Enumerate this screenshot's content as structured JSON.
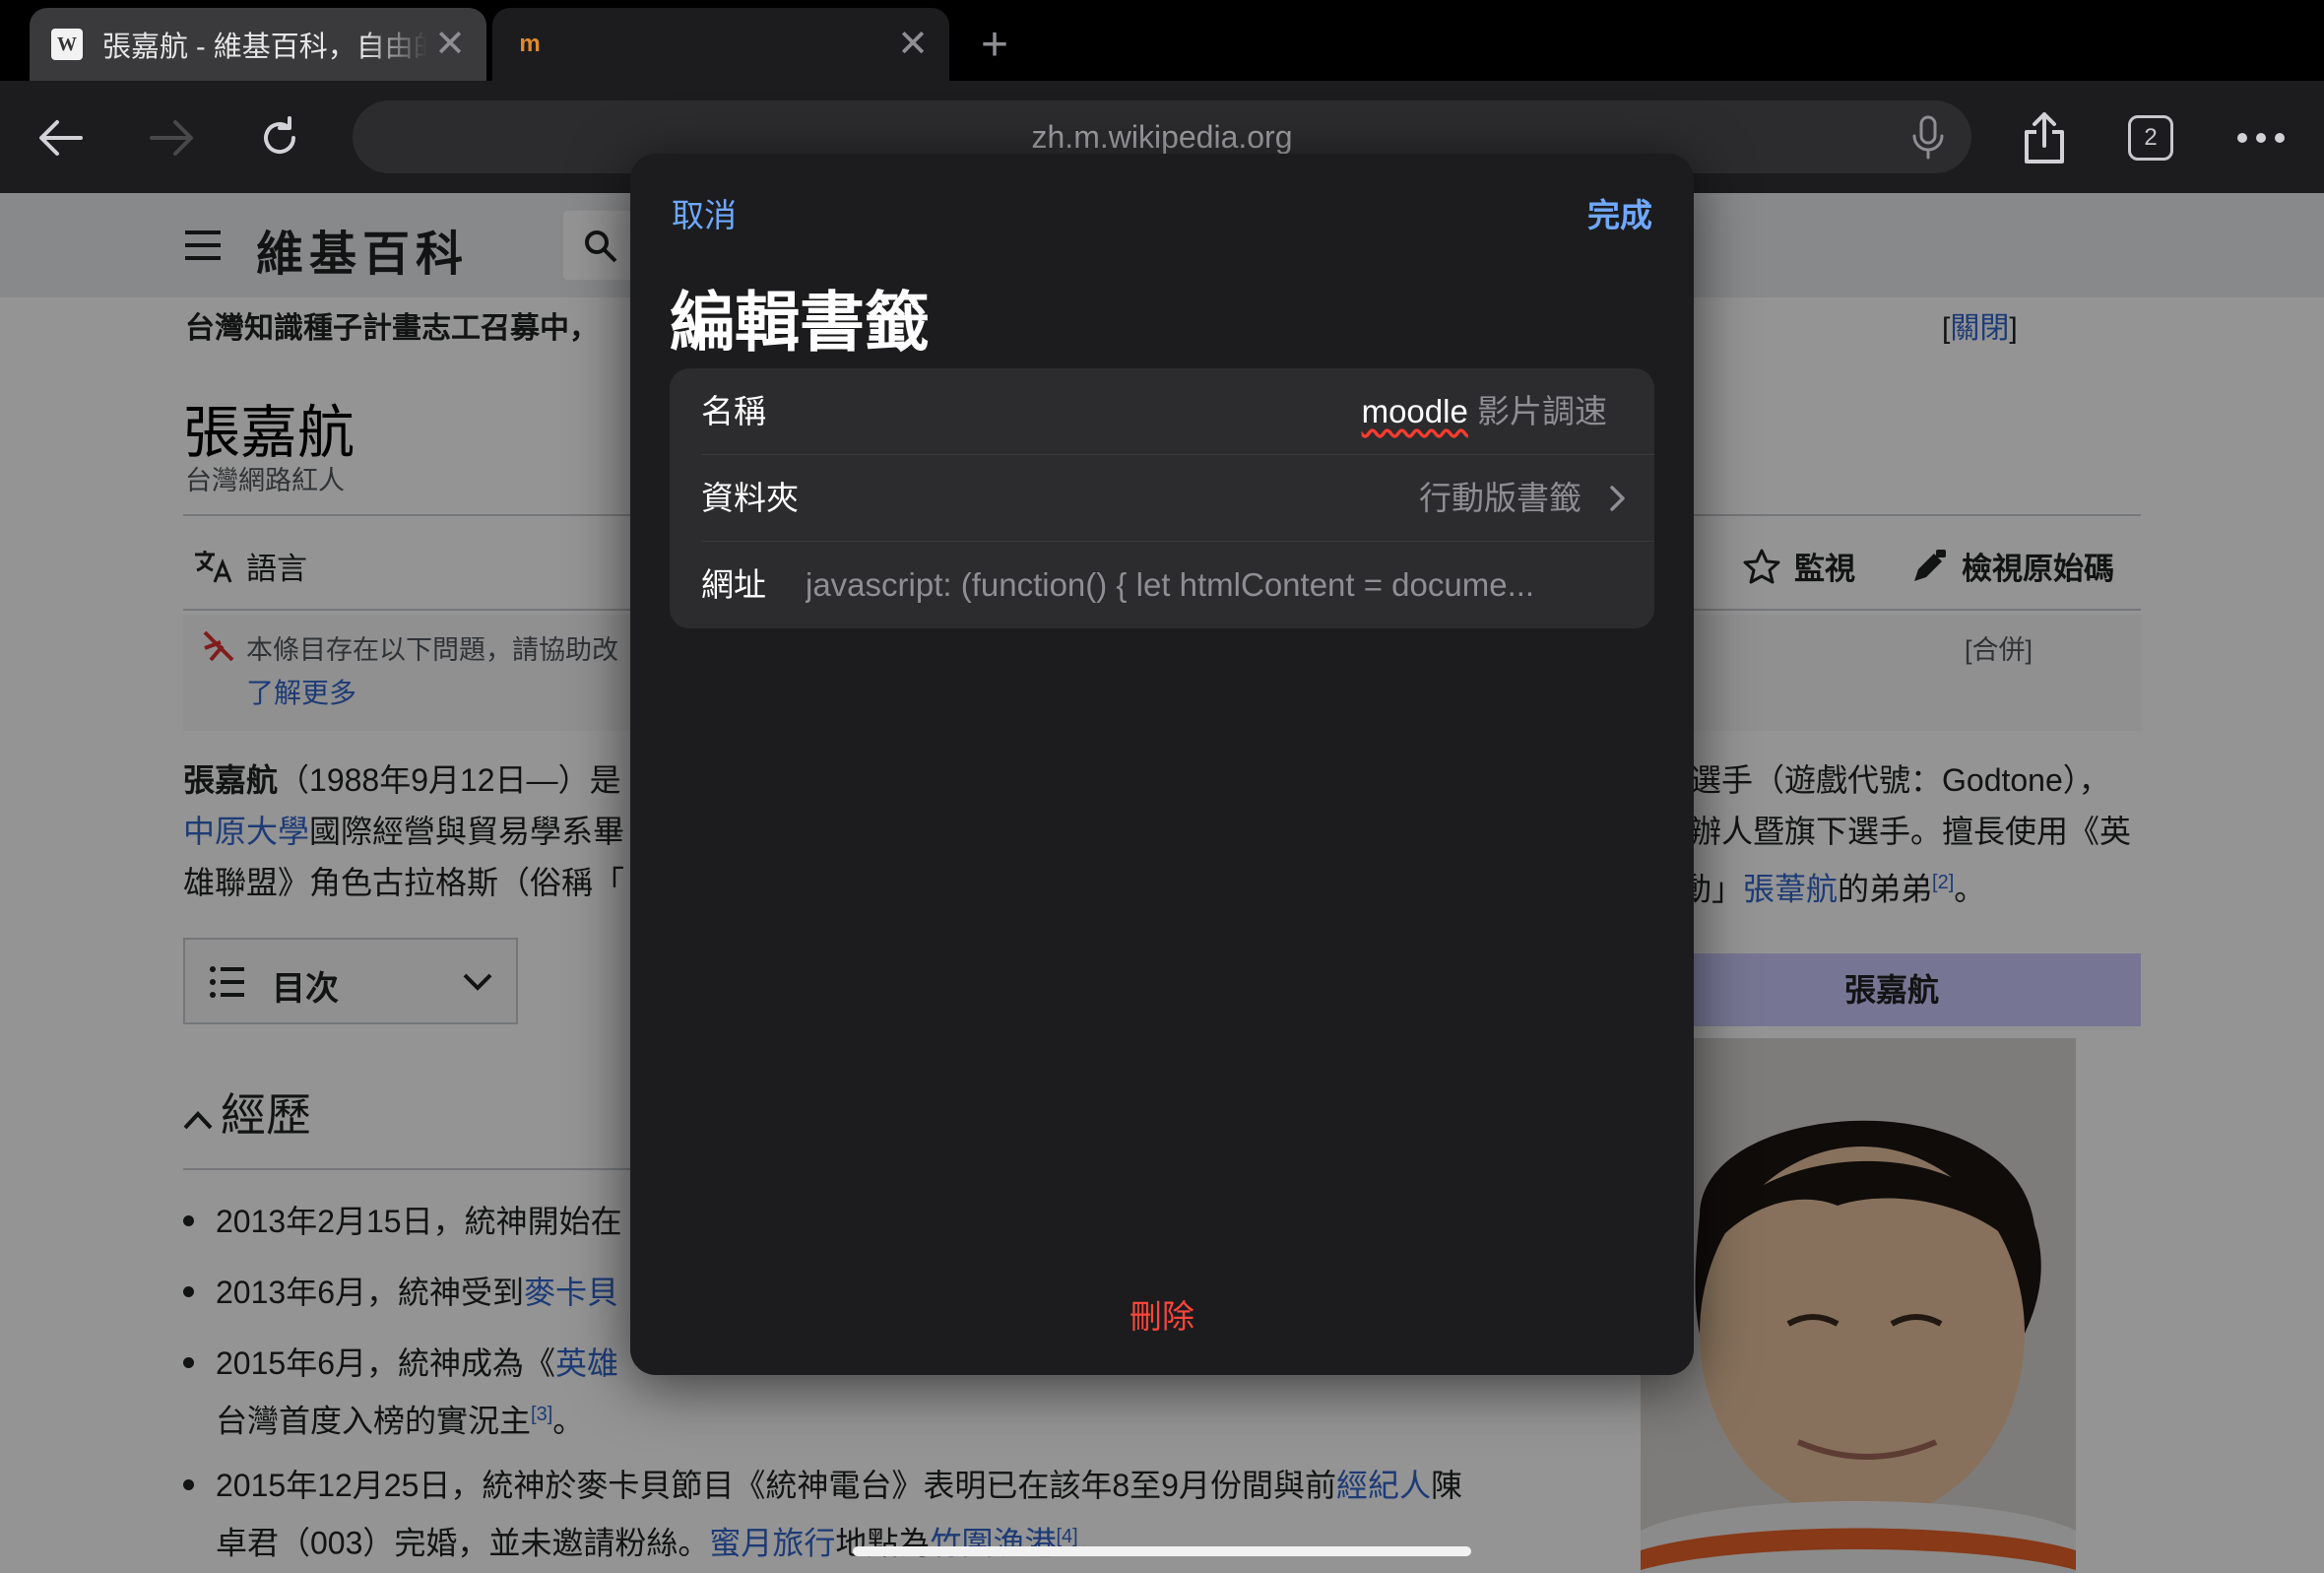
{
  "browser": {
    "tabs": [
      {
        "title": "張嘉航 - 維基百科，自由的百科全書",
        "favicon": "W",
        "close": "✕"
      },
      {
        "title": "",
        "favicon": "m",
        "close": "✕"
      }
    ],
    "new_tab": "+",
    "url": "zh.m.wikipedia.org",
    "tab_count": "2",
    "icons": [
      "back-arrow-icon",
      "forward-arrow-icon",
      "reload-icon",
      "microphone-icon",
      "share-icon",
      "tabs-icon",
      "more-icon"
    ]
  },
  "page": {
    "logo": "維基百科",
    "banner": "台灣知識種子計畫志工召募中，",
    "banner_close_open": "[",
    "banner_close": "關閉",
    "banner_close_end": "]",
    "title": "張嘉航",
    "subtitle": "台灣網路紅人",
    "language": "語言",
    "watch": "監視",
    "view_source": "檢視原始碼",
    "issue_text": "本條目存在以下問題，請協助改",
    "issue_more": "了解更多",
    "issue_merge": "[合併]",
    "para": {
      "l1_bold": "張嘉航",
      "l1_rest": "（1988年9月12日—）是",
      "l1_right": "選手（遊戲代號：Godtone），",
      "l2_link": "中原大學",
      "l2_rest": "國際經營與貿易學系畢",
      "l2_right": "辦人暨旗下選手。擅長使用《英",
      "l3_left": "雄聯盟》角色古拉格斯（俗稱「",
      "l3_right_a": "動」",
      "l3_right_link": "張葦航",
      "l3_right_b": "的弟弟",
      "l3_ref": "[2]",
      "l3_end": "。"
    },
    "toc": "目次",
    "section": "經歷",
    "list": [
      {
        "text": "2013年2月15日，統神開始在"
      },
      {
        "text": "2013年6月，統神受到",
        "link": "麥卡貝"
      },
      {
        "text": "2015年6月，統神成為《",
        "link": "英雄"
      },
      {
        "text": "台灣首度入榜的實況主",
        "ref": "[3]",
        "end": "。"
      },
      {
        "text": "2015年12月25日，統神於麥卡貝節目《統神電台》表明已在該年8至9月份間與前",
        "link": "經紀人",
        "end": "陳"
      },
      {
        "text": "卓君（003）完婚，並未邀請粉絲。",
        "link": "蜜月旅行",
        "mid": "地點為",
        "link2": "竹圍漁港",
        "ref": "[4]",
        "end": "。"
      }
    ],
    "infobox_title": "張嘉航"
  },
  "sheet": {
    "cancel": "取消",
    "done": "完成",
    "title": "編輯書籤",
    "name_label": "名稱",
    "name_word": "moodle",
    "name_rest": " 影片調速",
    "folder_label": "資料夾",
    "folder_value": "行動版書籤",
    "url_label": "網址",
    "url_value": "javascript: (function() {    let htmlContent = docume...",
    "delete": "刪除"
  },
  "colors": {
    "accent": "#6fa8ff",
    "destructive": "#ff453a",
    "sheet_bg": "#1c1c1e",
    "link": "#3366cc"
  }
}
